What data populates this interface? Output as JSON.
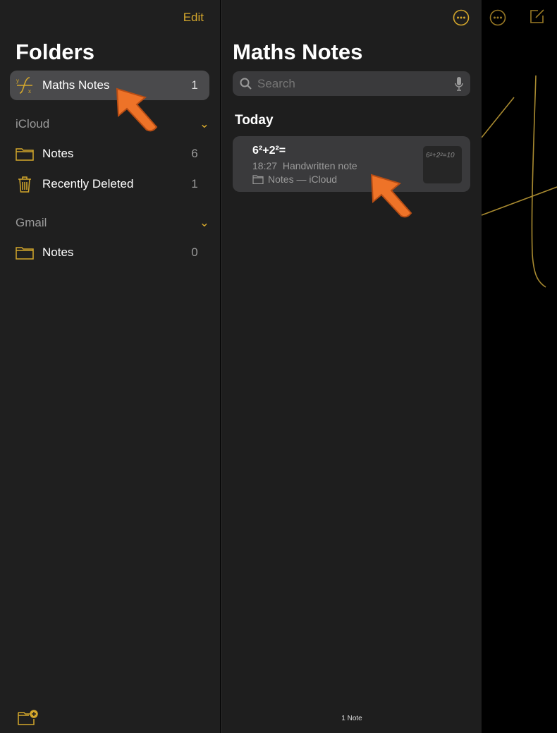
{
  "sidebar": {
    "edit": "Edit",
    "title": "Folders",
    "pinned": {
      "label": "Maths Notes",
      "count": "1",
      "icon": "math-function-icon"
    },
    "icloud": {
      "header": "iCloud",
      "items": [
        {
          "label": "Notes",
          "count": "6",
          "icon": "folder-icon"
        },
        {
          "label": "Recently Deleted",
          "count": "1",
          "icon": "trash-icon"
        }
      ]
    },
    "gmail": {
      "header": "Gmail",
      "items": [
        {
          "label": "Notes",
          "count": "0",
          "icon": "folder-icon"
        }
      ]
    }
  },
  "list": {
    "title": "Maths Notes",
    "search_placeholder": "Search",
    "section": "Today",
    "note": {
      "title": "6²+2²=",
      "time": "18:27",
      "type": "Handwritten note",
      "folder": "Notes — iCloud",
      "thumb": "6²+2²=10"
    },
    "footer": "1 Note"
  },
  "colors": {
    "accent": "#d4a72c",
    "annotation": "#ee7328"
  }
}
